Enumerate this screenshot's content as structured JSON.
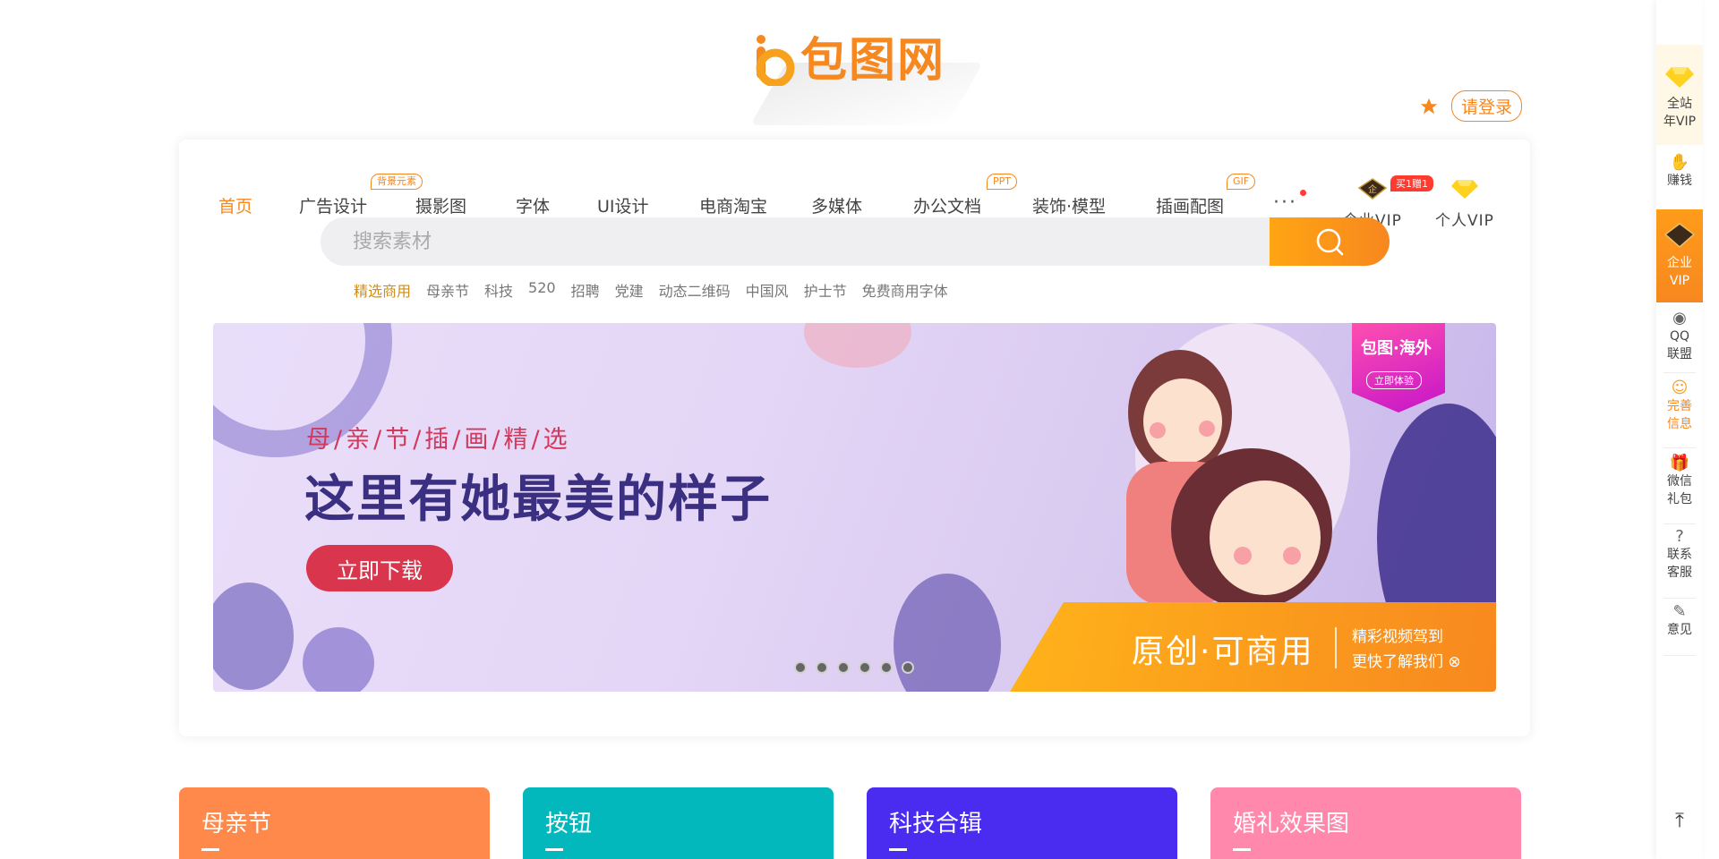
{
  "brand": {
    "name": "包图网"
  },
  "header": {
    "login_label": "请登录"
  },
  "nav": {
    "items": [
      "首页",
      "广告设计",
      "摄影图",
      "字体",
      "UI设计",
      "电商淘宝",
      "多媒体",
      "办公文档",
      "装饰·模型",
      "插画配图"
    ],
    "tags": {
      "ad": "背景元素",
      "office": "PPT",
      "illust": "GIF"
    },
    "more": "···",
    "enterprise_vip": "企业VIP",
    "personal_vip": "个人VIP",
    "vip_badge": "买1赠1",
    "enterprise_mark": "企"
  },
  "search": {
    "placeholder": "搜索素材",
    "hot": [
      "精选商用",
      "母亲节",
      "科技",
      "520",
      "招聘",
      "党建",
      "动态二维码",
      "中国风",
      "护士节",
      "免费商用字体"
    ]
  },
  "banner": {
    "subtitle": "母/亲/节/插/画/精/选",
    "title": "这里有她最美的样子",
    "button": "立即下载",
    "strip_main": "原创·可商用",
    "strip_right_1": "精彩视频驾到",
    "strip_right_2": "更快了解我们",
    "overseas_title": "包图·海外",
    "overseas_btn": "立即体验",
    "slide_count": 6
  },
  "categories": [
    {
      "label": "母亲节",
      "color": "#ff884b"
    },
    {
      "label": "按钮",
      "color": "#03b8bd"
    },
    {
      "label": "科技合辑",
      "color": "#4a2bf0"
    },
    {
      "label": "婚礼效果图",
      "color": "#ff88ac"
    }
  ],
  "sidebar": {
    "vip_all_1": "全站",
    "vip_all_2": "年VIP",
    "earn": "赚钱",
    "enterprise_1": "企业",
    "enterprise_2": "VIP",
    "qq_1": "QQ",
    "qq_2": "联盟",
    "info_1": "完善",
    "info_2": "信息",
    "wechat_1": "微信",
    "wechat_2": "礼包",
    "service_1": "联系",
    "service_2": "客服",
    "feedback": "意见"
  },
  "colors": {
    "accent": "#f7871f",
    "banner_title": "#3a2f80",
    "banner_button": "#d9364d"
  }
}
